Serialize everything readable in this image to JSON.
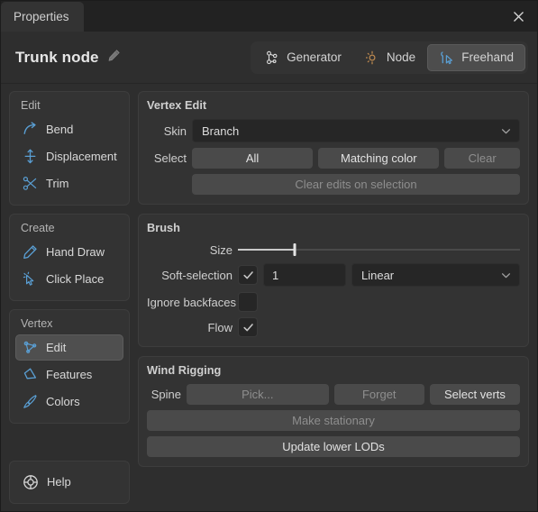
{
  "window": {
    "tab_label": "Properties",
    "close_icon": "close-icon"
  },
  "header": {
    "title": "Trunk node",
    "edit_icon": "pencil-icon",
    "mode_tabs": [
      {
        "label": "Generator",
        "icon": "node-tree-icon",
        "active": false,
        "icon_color": "#dedede"
      },
      {
        "label": "Node",
        "icon": "node-point-icon",
        "active": false,
        "icon_color": "#c08b50"
      },
      {
        "label": "Freehand",
        "icon": "freehand-cursor-icon",
        "active": true,
        "icon_color": "#5a9fd4"
      }
    ]
  },
  "sidebar": {
    "groups": [
      {
        "title": "Edit",
        "items": [
          {
            "label": "Bend",
            "icon": "bend-arrow-icon",
            "selected": false
          },
          {
            "label": "Displacement",
            "icon": "displacement-arrow-icon",
            "selected": false
          },
          {
            "label": "Trim",
            "icon": "scissors-icon",
            "selected": false
          }
        ]
      },
      {
        "title": "Create",
        "items": [
          {
            "label": "Hand Draw",
            "icon": "pencil-icon",
            "selected": false
          },
          {
            "label": "Click Place",
            "icon": "click-cursor-icon",
            "selected": false
          }
        ]
      },
      {
        "title": "Vertex",
        "items": [
          {
            "label": "Edit",
            "icon": "vertex-edit-icon",
            "selected": true
          },
          {
            "label": "Features",
            "icon": "polygon-icon",
            "selected": false
          },
          {
            "label": "Colors",
            "icon": "paintbrush-icon",
            "selected": false
          }
        ]
      }
    ],
    "help": {
      "label": "Help",
      "icon": "lifebuoy-icon"
    }
  },
  "panels": {
    "vertex_edit": {
      "title": "Vertex Edit",
      "skin_label": "Skin",
      "skin_value": "Branch",
      "select_label": "Select",
      "select_all": "All",
      "select_matching": "Matching color",
      "select_clear": "Clear",
      "clear_edits": "Clear edits on selection"
    },
    "brush": {
      "title": "Brush",
      "size_label": "Size",
      "size_percent": 20,
      "soft_selection_label": "Soft-selection",
      "soft_selection_checked": true,
      "soft_selection_value": "1",
      "falloff_value": "Linear",
      "ignore_backfaces_label": "Ignore backfaces",
      "ignore_backfaces_checked": false,
      "flow_label": "Flow",
      "flow_checked": true
    },
    "wind_rigging": {
      "title": "Wind Rigging",
      "spine_label": "Spine",
      "spine_pick": "Pick...",
      "spine_forget": "Forget",
      "spine_select_verts": "Select verts",
      "make_stationary": "Make stationary",
      "update_lods": "Update lower LODs"
    }
  },
  "colors": {
    "accent_blue": "#5a9fd4",
    "accent_orange": "#c08b50",
    "panel_bg": "#333333",
    "window_bg": "#2e2e2e",
    "field_bg": "#262626",
    "button_bg": "#4a4a4a"
  }
}
